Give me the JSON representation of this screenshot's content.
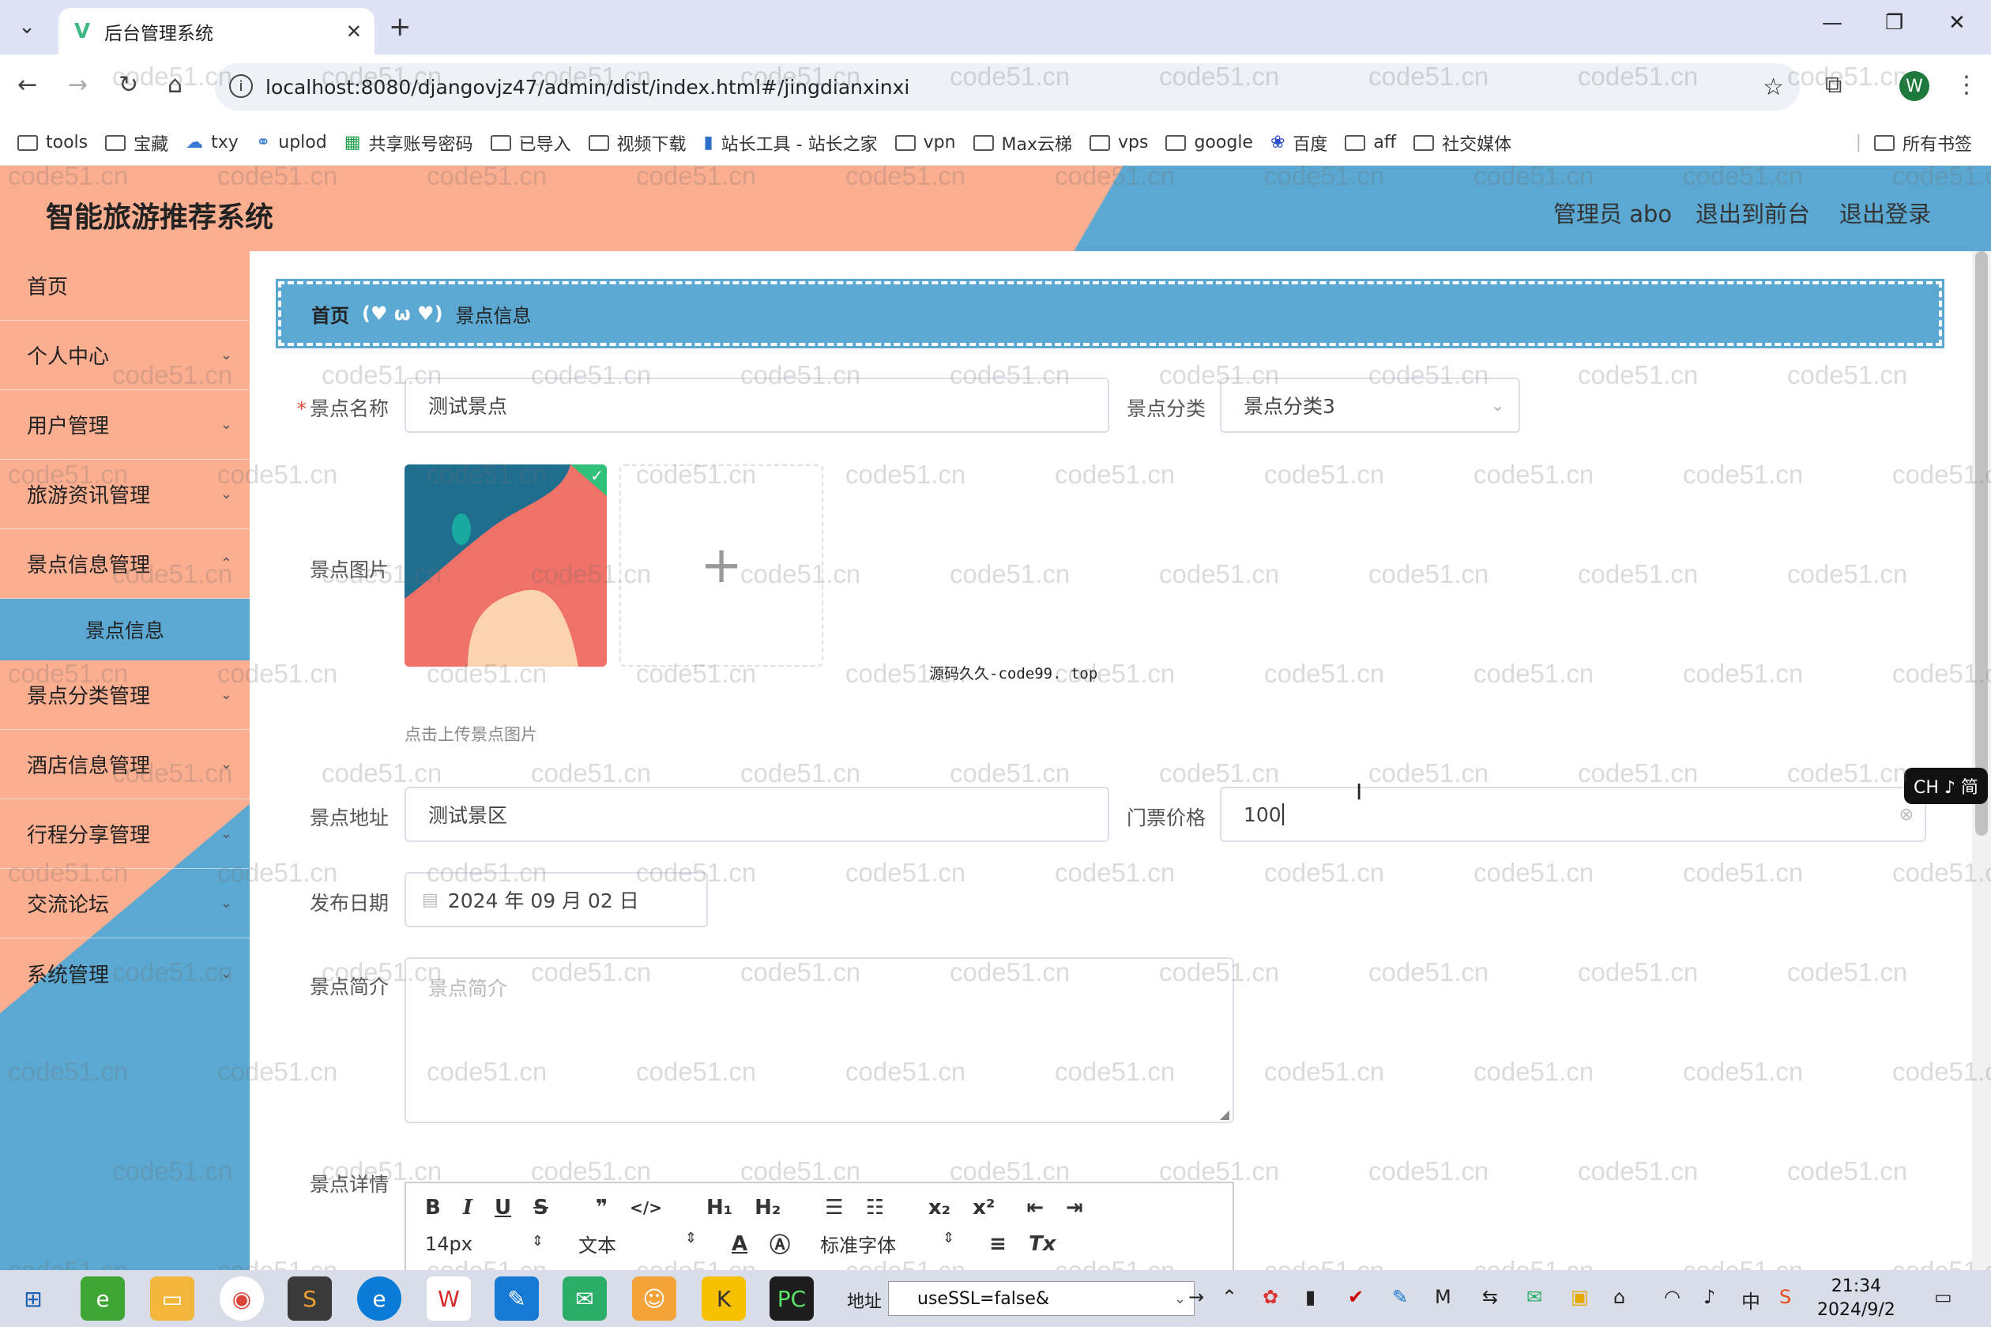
{
  "browser": {
    "tab_title": "后台管理系统",
    "url": "localhost:8080/djangovjz47/admin/dist/index.html#/jingdianxinxi",
    "bookmarks": [
      "tools",
      "宝藏",
      "txy",
      "uplod",
      "共享账号密码",
      "已导入",
      "视频下载",
      "站长工具 - 站长之家",
      "vpn",
      "Max云梯",
      "vps",
      "google",
      "百度",
      "aff",
      "社交媒体"
    ],
    "all_bookmarks": "所有书签",
    "profile_initial": "W"
  },
  "app": {
    "title": "智能旅游推荐系统",
    "header_links": [
      "管理员 abo",
      "退出到前台",
      "退出登录"
    ]
  },
  "sidebar": {
    "items": [
      "首页",
      "个人中心",
      "用户管理",
      "旅游资讯管理",
      "景点信息管理"
    ],
    "active_sub": "景点信息",
    "items_after": [
      "景点分类管理",
      "酒店信息管理",
      "行程分享管理",
      "交流论坛",
      "系统管理"
    ]
  },
  "breadcrumb": {
    "home": "首页",
    "emote": "(♥ ω ♥)",
    "current": "景点信息"
  },
  "form": {
    "name_label": "景点名称",
    "name_value": "测试景点",
    "category_label": "景点分类",
    "category_value": "景点分类3",
    "image_label": "景点图片",
    "upload_hint": "点击上传景点图片",
    "watermark_caption": "源码久久-code99. top",
    "address_label": "景点地址",
    "address_value": "测试景区",
    "price_label": "门票价格",
    "price_value": "100",
    "date_label": "发布日期",
    "date_value": "2024 年 09 月 02 日",
    "intro_label": "景点简介",
    "intro_placeholder": "景点简介",
    "detail_label": "景点详情"
  },
  "editor": {
    "font_size": "14px",
    "format": "文本",
    "font": "标准字体"
  },
  "watermark": "code51.cn",
  "ime": "CH ♪ 简",
  "taskbar": {
    "address_label": "地址",
    "address_value": "useSSL=false&",
    "ime_lang": "中",
    "time": "21:34",
    "date": "2024/9/2"
  },
  "colors": {
    "salmon": "#fcae90",
    "blue": "#5ba8d2"
  }
}
